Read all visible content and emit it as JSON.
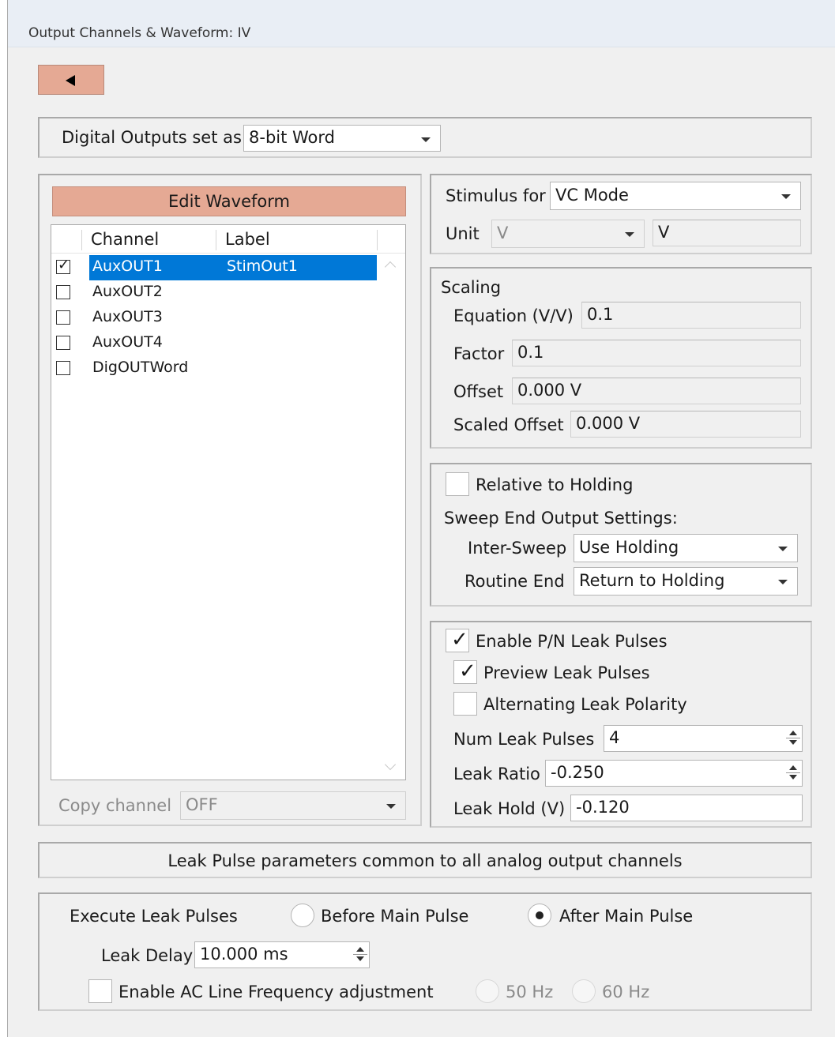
{
  "window": {
    "title": "Output Channels & Waveform: IV"
  },
  "back_button": {
    "icon": "back-arrow-icon"
  },
  "digital_outputs": {
    "label": "Digital Outputs set as",
    "value": "8-bit Word"
  },
  "waveform": {
    "edit_button": "Edit Waveform",
    "columns": [
      "Channel",
      "Label"
    ],
    "channels": [
      {
        "name": "AuxOUT1",
        "label": "StimOut1",
        "checked": true,
        "selected": true
      },
      {
        "name": "AuxOUT2",
        "label": "",
        "checked": false,
        "selected": false
      },
      {
        "name": "AuxOUT3",
        "label": "",
        "checked": false,
        "selected": false
      },
      {
        "name": "AuxOUT4",
        "label": "",
        "checked": false,
        "selected": false
      },
      {
        "name": "DigOUTWord",
        "label": "",
        "checked": false,
        "selected": false
      }
    ],
    "copy_channel_label": "Copy channel",
    "copy_channel_value": "OFF"
  },
  "stimulus": {
    "label": "Stimulus for",
    "value": "VC Mode",
    "unit_label": "Unit",
    "unit_value": "V",
    "unit_display": "V"
  },
  "scaling": {
    "title": "Scaling",
    "equation_label": "Equation (V/V)",
    "equation_value": "0.1",
    "factor_label": "Factor",
    "factor_value": "0.1",
    "offset_label": "Offset",
    "offset_value": "0.000 V",
    "scaled_offset_label": "Scaled Offset",
    "scaled_offset_value": "0.000 V"
  },
  "sweep": {
    "relative_label": "Relative to Holding",
    "section_label": "Sweep End Output Settings:",
    "inter_sweep_label": "Inter-Sweep",
    "inter_sweep_value": "Use Holding",
    "routine_end_label": "Routine End",
    "routine_end_value": "Return to Holding"
  },
  "leak": {
    "enable_label": "Enable P/N Leak Pulses",
    "preview_label": "Preview Leak Pulses",
    "alternating_label": "Alternating Leak Polarity",
    "num_label": "Num Leak Pulses",
    "num_value": "4",
    "ratio_label": "Leak Ratio",
    "ratio_value": "-0.250",
    "hold_label": "Leak Hold (V)",
    "hold_value": "-0.120",
    "checkmark": "✓"
  },
  "common": {
    "banner": "Leak Pulse parameters common to all analog output channels",
    "execute_label": "Execute Leak Pulses",
    "before_label": "Before Main Pulse",
    "after_label": "After Main Pulse",
    "delay_label": "Leak Delay",
    "delay_value": "10.000 ms",
    "ac_label": "Enable AC Line Frequency adjustment",
    "hz50": "50 Hz",
    "hz60": "60 Hz"
  },
  "colors": {
    "accent_button": "#e5a994",
    "selection": "#0078d7"
  }
}
